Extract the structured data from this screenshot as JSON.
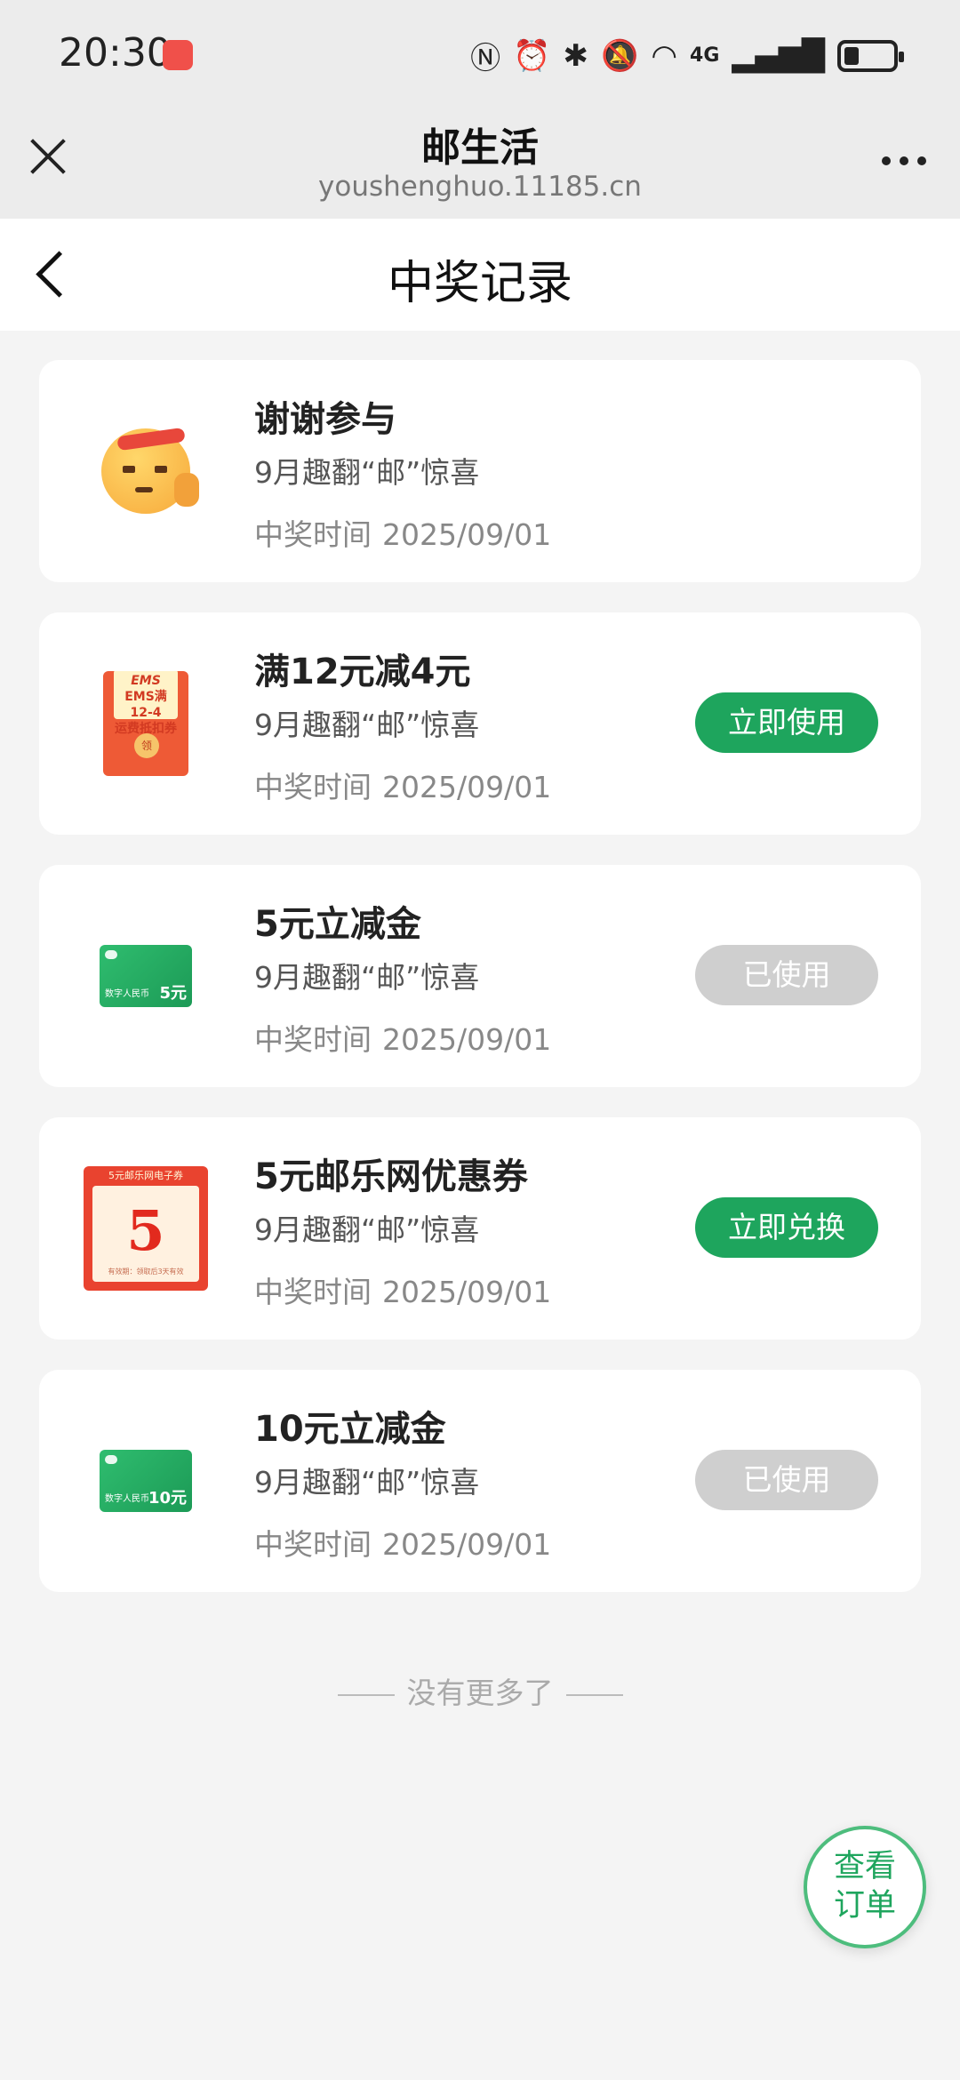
{
  "status_bar": {
    "time": "20:30",
    "network_label": "4G"
  },
  "browser": {
    "title": "邮生活",
    "url": "youshenghuo.11185.cn"
  },
  "page": {
    "title": "中奖记录"
  },
  "records": [
    {
      "title": "谢谢参与",
      "activity": "9月趣翻“邮”惊喜",
      "time_label": "中奖时间",
      "time_value": "2025/09/01",
      "thumb": "emoji-face-icon",
      "button": null
    },
    {
      "title": "满12元减4元",
      "activity": "9月趣翻“邮”惊喜",
      "time_label": "中奖时间",
      "time_value": "2025/09/01",
      "thumb": "ems-red-envelope",
      "thumb_text": {
        "brand": "EMS",
        "line": "EMS满12-4",
        "line2": "运费抵扣券",
        "seal": "领"
      },
      "button": {
        "label": "立即使用",
        "state": "active"
      }
    },
    {
      "title": "5元立减金",
      "activity": "9月趣翻“邮”惊喜",
      "time_label": "中奖时间",
      "time_value": "2025/09/01",
      "thumb": "cash-card",
      "thumb_text": {
        "amount": "5元",
        "label": "数字人民币"
      },
      "button": {
        "label": "已使用",
        "state": "disabled"
      }
    },
    {
      "title": "5元邮乐网优惠券",
      "activity": "9月趣翻“邮”惊喜",
      "time_label": "中奖时间",
      "time_value": "2025/09/01",
      "thumb": "youle-coupon",
      "thumb_text": {
        "head": "5元邮乐网电子券",
        "num": "5",
        "foot": "有效期：领取后3天有效"
      },
      "button": {
        "label": "立即兑换",
        "state": "active"
      }
    },
    {
      "title": "10元立减金",
      "activity": "9月趣翻“邮”惊喜",
      "time_label": "中奖时间",
      "time_value": "2025/09/01",
      "thumb": "cash-card",
      "thumb_text": {
        "amount": "10元",
        "label": "数字人民币"
      },
      "button": {
        "label": "已使用",
        "state": "disabled"
      }
    }
  ],
  "footer_note": "没有更多了",
  "fab": {
    "line1": "查看",
    "line2": "订单"
  },
  "colors": {
    "accent": "#1ea55d",
    "disabled": "#cfcfcf",
    "background": "#f4f4f4"
  }
}
